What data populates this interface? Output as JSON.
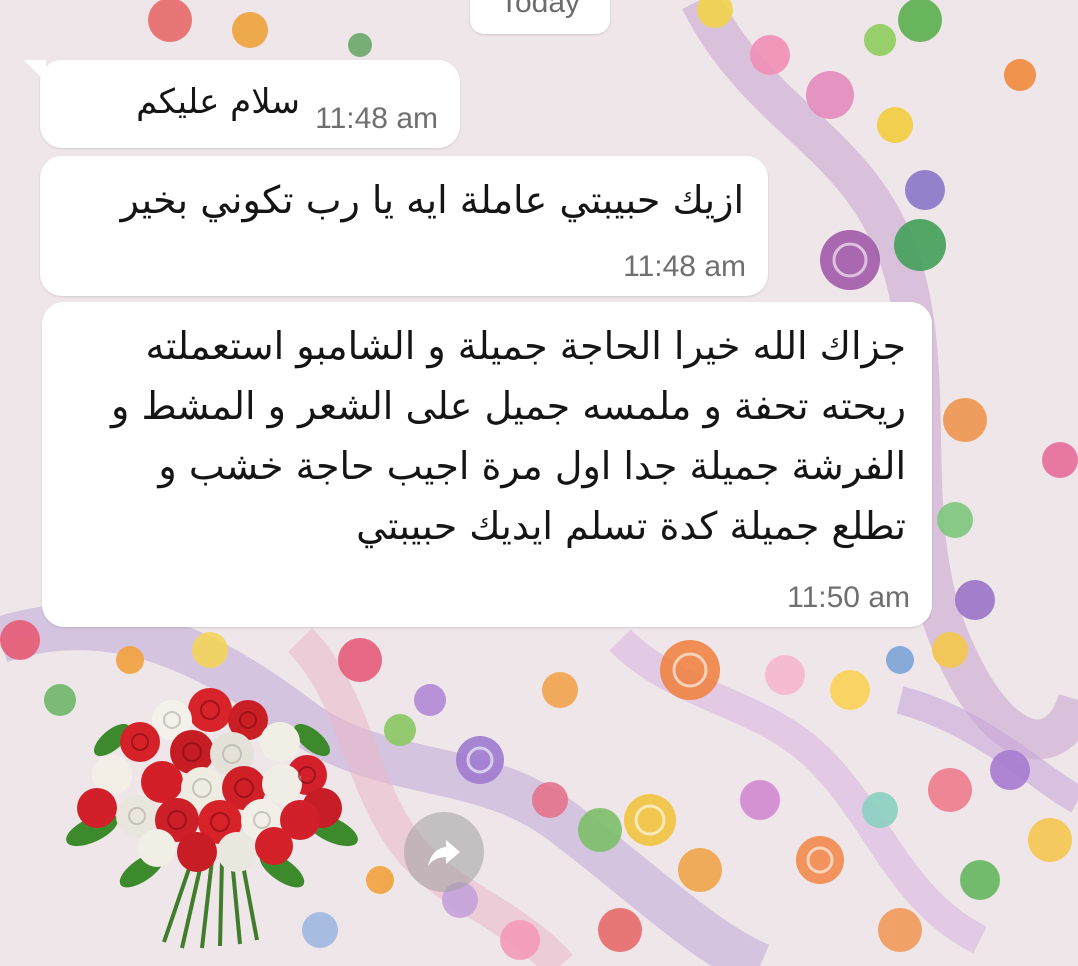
{
  "chat": {
    "date_divider": "Today",
    "messages": [
      {
        "text": "سلام عليكم",
        "time": "11:48 am"
      },
      {
        "text": "ازيك حبيبتي عاملة ايه يا رب تكوني بخير",
        "time": "11:48 am"
      },
      {
        "text": "جزاك الله خيرا الحاجة جميلة و الشامبو استعملته ريحته تحفة و ملمسه جميل على الشعر و المشط و الفرشة جميلة جدا اول مرة اجيب حاجة خشب و تطلع جميلة كدة تسلم ايديك حبيبتي",
        "time": "11:50 am"
      }
    ],
    "sticker": {
      "icon": "rose-bouquet-icon"
    },
    "forward_button": {
      "icon": "forward-arrow-icon"
    }
  },
  "colors": {
    "bubble": "#ffffff",
    "timestamp": "#6f6f6f",
    "text": "#151515"
  }
}
